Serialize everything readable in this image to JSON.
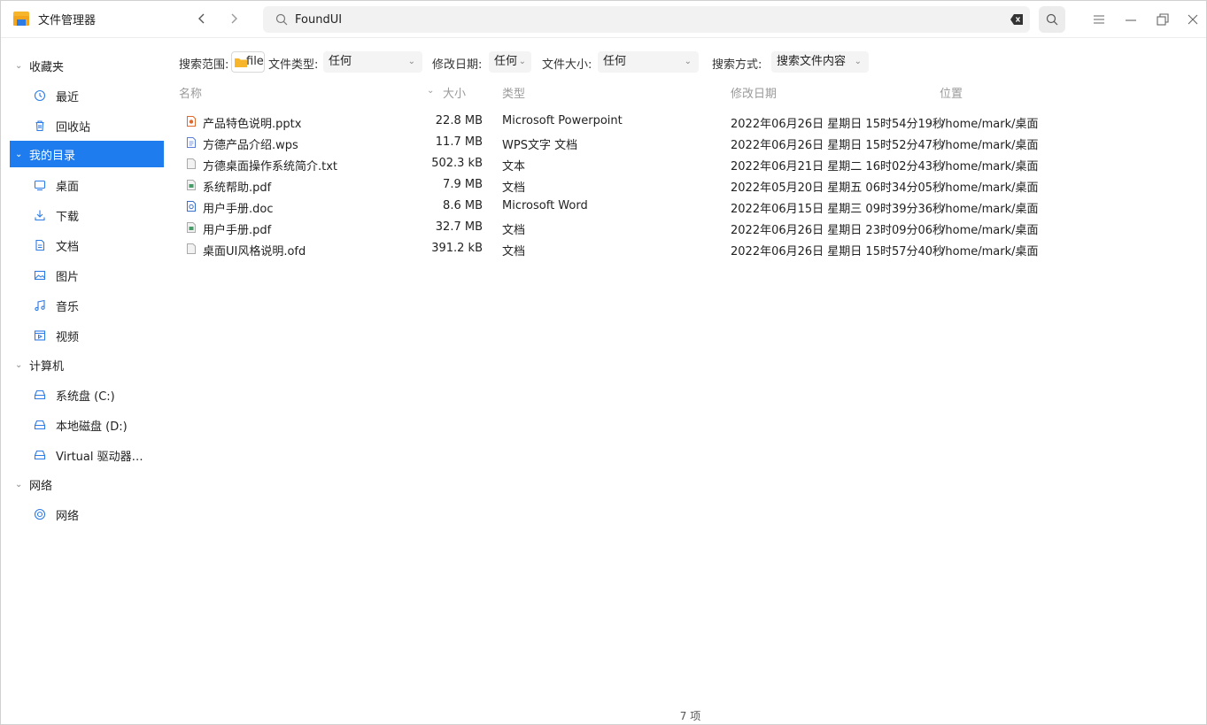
{
  "app": {
    "title": "文件管理器"
  },
  "search": {
    "value": "FoundUI"
  },
  "sidebar": {
    "groups": [
      {
        "label": "收藏夹"
      },
      {
        "label": "我的目录"
      },
      {
        "label": "计算机"
      },
      {
        "label": "网络"
      }
    ],
    "items": [
      {
        "label": "最近",
        "icon": "clock-icon"
      },
      {
        "label": "回收站",
        "icon": "trash-icon"
      },
      {
        "label": "桌面",
        "icon": "desktop-icon"
      },
      {
        "label": "下载",
        "icon": "download-icon"
      },
      {
        "label": "文档",
        "icon": "document-icon"
      },
      {
        "label": "图片",
        "icon": "image-icon"
      },
      {
        "label": "音乐",
        "icon": "music-icon"
      },
      {
        "label": "视频",
        "icon": "video-icon"
      },
      {
        "label": "系统盘 (C:)",
        "icon": "drive-icon"
      },
      {
        "label": "本地磁盘 (D:)",
        "icon": "drive-icon"
      },
      {
        "label": "Virtual 驱动器…",
        "icon": "drive-icon"
      },
      {
        "label": "网络",
        "icon": "network-icon"
      }
    ]
  },
  "filters": {
    "scope_label": "搜索范围:",
    "scope_value": "file",
    "type_label": "文件类型:",
    "type_value": "任何",
    "date_label": "修改日期:",
    "date_value": "任何",
    "size_label": "文件大小:",
    "size_value": "任何",
    "method_label": "搜索方式:",
    "method_value": "搜索文件内容"
  },
  "columns": {
    "name": "名称",
    "size": "大小",
    "type": "类型",
    "modified": "修改日期",
    "location": "位置"
  },
  "files": [
    {
      "name": "产品特色说明.pptx",
      "size": "22.8 MB",
      "type": "Microsoft Powerpoint",
      "modified": "2022年06月26日 星期日 15时54分19秒",
      "location": "/home/mark/桌面",
      "icon": "pptx-file-icon"
    },
    {
      "name": "方德产品介绍.wps",
      "size": "11.7 MB",
      "type": "WPS文字 文档",
      "modified": "2022年06月26日 星期日 15时52分47秒",
      "location": "/home/mark/桌面",
      "icon": "wps-file-icon"
    },
    {
      "name": "方德桌面操作系统简介.txt",
      "size": "502.3 kB",
      "type": "文本",
      "modified": "2022年06月21日 星期二 16时02分43秒",
      "location": "/home/mark/桌面",
      "icon": "txt-file-icon"
    },
    {
      "name": "系统帮助.pdf",
      "size": "7.9 MB",
      "type": "文档",
      "modified": "2022年05月20日 星期五 06时34分05秒",
      "location": "/home/mark/桌面",
      "icon": "pdf-file-icon"
    },
    {
      "name": "用户手册.doc",
      "size": "8.6 MB",
      "type": "Microsoft Word",
      "modified": "2022年06月15日 星期三 09时39分36秒",
      "location": "/home/mark/桌面",
      "icon": "doc-file-icon"
    },
    {
      "name": "用户手册.pdf",
      "size": "32.7 MB",
      "type": "文档",
      "modified": "2022年06月26日 星期日 23时09分06秒",
      "location": "/home/mark/桌面",
      "icon": "pdf-file-icon"
    },
    {
      "name": "桌面UI风格说明.ofd",
      "size": "391.2 kB",
      "type": "文档",
      "modified": "2022年06月26日 星期日 15时57分40秒",
      "location": "/home/mark/桌面",
      "icon": "ofd-file-icon"
    }
  ],
  "status": {
    "count": "7 项"
  },
  "colors": {
    "accent": "#1f7cef",
    "logo_yellow": "#f7b52c",
    "logo_blue": "#2d7be5"
  }
}
